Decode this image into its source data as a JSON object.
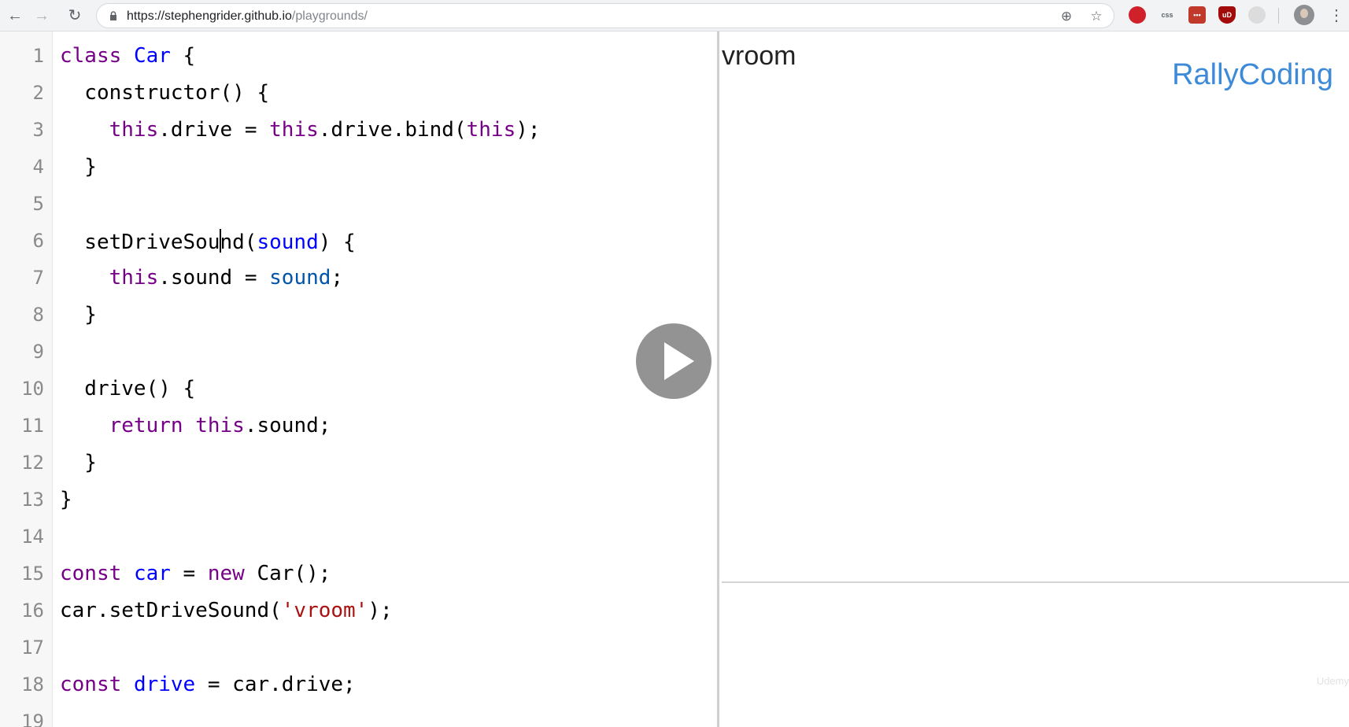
{
  "browser": {
    "url_host": "https://stephengrider.github.io",
    "url_path": "/playgrounds/",
    "extensions": [
      {
        "name": "opera-icon",
        "color": "#d0202a",
        "label": ""
      },
      {
        "name": "css-icon",
        "color": "#ffffff",
        "label": "css"
      },
      {
        "name": "dots-extension-icon",
        "color": "#c0392b",
        "label": "•••"
      },
      {
        "name": "ublock-icon",
        "color": "#a30b0b",
        "label": "uD"
      },
      {
        "name": "disabled-extension-icon",
        "color": "#dcdcdc",
        "label": ""
      }
    ]
  },
  "editor": {
    "line_numbers": [
      "1",
      "2",
      "3",
      "4",
      "5",
      "6",
      "7",
      "8",
      "9",
      "10",
      "11",
      "12",
      "13",
      "14",
      "15",
      "16",
      "17",
      "18",
      "19"
    ]
  },
  "output": {
    "text": "vroom",
    "brand": "RallyCoding",
    "watermark": "Udemy"
  },
  "colors": {
    "keyword": "#770088",
    "definition": "#0000ff",
    "variable": "#0055aa",
    "string": "#aa1111",
    "brand": "#3d8bd8"
  }
}
